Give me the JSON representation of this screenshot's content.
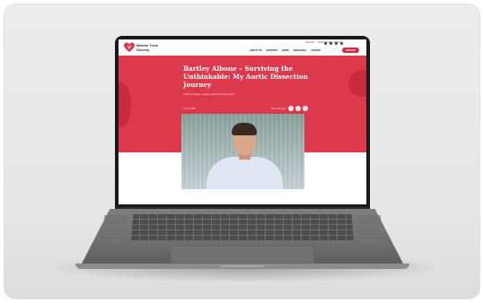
{
  "site": {
    "logo_text": "Marfan Trust Society",
    "top_links": "SUPPORTERS  ABOUT",
    "donate_small": "DONATE",
    "nav": [
      "ABOUT US",
      "SUPPORT",
      "NEWS",
      "RESEARCH",
      "EVENTS"
    ],
    "nav_button": "DONATE"
  },
  "article": {
    "title": "Bartley Albone – Surviving the Unthinkable: My Aortic Dissection Journey",
    "subtitle": "A story of courage, recovery, and the strength of hope",
    "date": "17 Nov 2023",
    "share_label": "Share this story"
  },
  "colors": {
    "brand_red": "#dc3a4c",
    "background": "#e6e6e6",
    "laptop_body": "#6e6e6e"
  }
}
